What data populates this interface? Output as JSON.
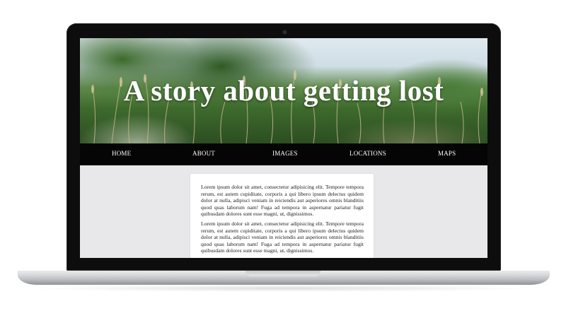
{
  "hero": {
    "title": "A story about getting lost"
  },
  "nav": {
    "items": [
      {
        "label": "HOME"
      },
      {
        "label": "ABOUT"
      },
      {
        "label": "IMAGES"
      },
      {
        "label": "LOCATIONS"
      },
      {
        "label": "MAPS"
      }
    ]
  },
  "content": {
    "paragraphs": [
      "Lorem ipsum dolor sit amet, consectetur adipisicing elit. Tempore tempora rerum, est autem cupiditate, corporis a qui libero ipsum delectus quidem dolor at nulla, adipisci veniam in reiciendis aut asperiores omnis blanditiis quod quas laborum nam! Fuga ad tempora in aspernatur pariatur fugit quibusdam dolores sunt esse magni, ut, dignissimos.",
      "Lorem ipsum dolor sit amet, consectetur adipisicing elit. Tempore tempora rerum, est autem cupiditate, corporis a qui libero ipsum delectus quidem dolor at nulla, adipisci veniam in reiciendis aut asperiores omnis blanditiis quod quas laborum nam! Fuga ad tempora in aspernatur pariatur fugit quibusdam dolores sunt esse magni, ut, dignissimos."
    ]
  },
  "colors": {
    "nav_background": "#050505",
    "page_background": "#e8e8ea",
    "card_background": "#ffffff"
  }
}
